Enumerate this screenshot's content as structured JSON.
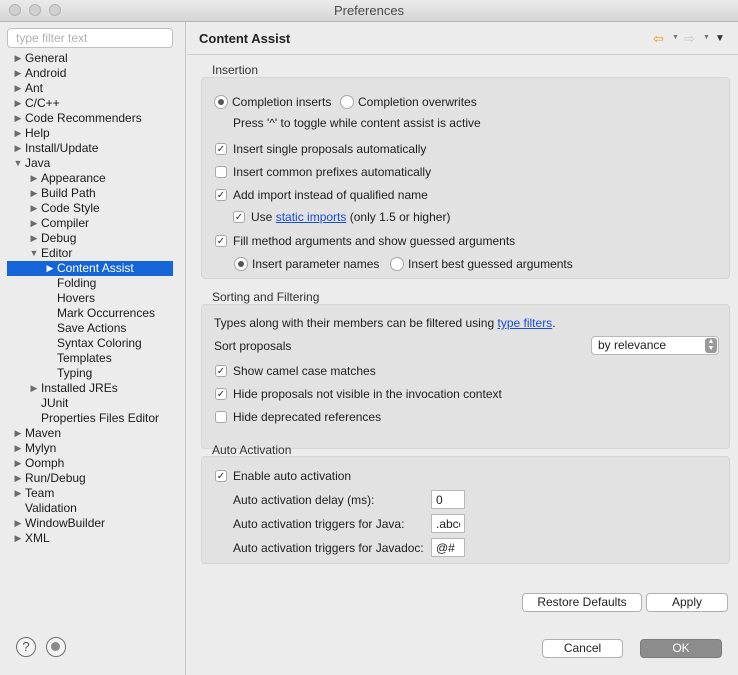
{
  "window": {
    "title": "Preferences"
  },
  "filter": {
    "placeholder": "type filter text"
  },
  "tree": [
    {
      "label": "General",
      "arrow": "▶",
      "depth": 0
    },
    {
      "label": "Android",
      "arrow": "▶",
      "depth": 0
    },
    {
      "label": "Ant",
      "arrow": "▶",
      "depth": 0
    },
    {
      "label": "C/C++",
      "arrow": "▶",
      "depth": 0
    },
    {
      "label": "Code Recommenders",
      "arrow": "▶",
      "depth": 0
    },
    {
      "label": "Help",
      "arrow": "▶",
      "depth": 0
    },
    {
      "label": "Install/Update",
      "arrow": "▶",
      "depth": 0
    },
    {
      "label": "Java",
      "arrow": "▼",
      "depth": 0
    },
    {
      "label": "Appearance",
      "arrow": "▶",
      "depth": 1
    },
    {
      "label": "Build Path",
      "arrow": "▶",
      "depth": 1
    },
    {
      "label": "Code Style",
      "arrow": "▶",
      "depth": 1
    },
    {
      "label": "Compiler",
      "arrow": "▶",
      "depth": 1
    },
    {
      "label": "Debug",
      "arrow": "▶",
      "depth": 1
    },
    {
      "label": "Editor",
      "arrow": "▼",
      "depth": 1
    },
    {
      "label": "Content Assist",
      "arrow": "▶",
      "depth": 2,
      "selected": true
    },
    {
      "label": "Folding",
      "arrow": "",
      "depth": 2
    },
    {
      "label": "Hovers",
      "arrow": "",
      "depth": 2
    },
    {
      "label": "Mark Occurrences",
      "arrow": "",
      "depth": 2
    },
    {
      "label": "Save Actions",
      "arrow": "",
      "depth": 2
    },
    {
      "label": "Syntax Coloring",
      "arrow": "",
      "depth": 2
    },
    {
      "label": "Templates",
      "arrow": "",
      "depth": 2
    },
    {
      "label": "Typing",
      "arrow": "",
      "depth": 2
    },
    {
      "label": "Installed JREs",
      "arrow": "▶",
      "depth": 1
    },
    {
      "label": "JUnit",
      "arrow": "",
      "depth": 1
    },
    {
      "label": "Properties Files Editor",
      "arrow": "",
      "depth": 1
    },
    {
      "label": "Maven",
      "arrow": "▶",
      "depth": 0
    },
    {
      "label": "Mylyn",
      "arrow": "▶",
      "depth": 0
    },
    {
      "label": "Oomph",
      "arrow": "▶",
      "depth": 0
    },
    {
      "label": "Run/Debug",
      "arrow": "▶",
      "depth": 0
    },
    {
      "label": "Team",
      "arrow": "▶",
      "depth": 0
    },
    {
      "label": "Validation",
      "arrow": "",
      "depth": 0
    },
    {
      "label": "WindowBuilder",
      "arrow": "▶",
      "depth": 0
    },
    {
      "label": "XML",
      "arrow": "▶",
      "depth": 0
    }
  ],
  "page": {
    "title": "Content Assist"
  },
  "insertion": {
    "title": "Insertion",
    "completion_inserts": "Completion inserts",
    "completion_overwrites": "Completion overwrites",
    "toggle_hint": "Press '^' to toggle while content assist is active",
    "insert_single": "Insert single proposals automatically",
    "insert_common": "Insert common prefixes automatically",
    "add_import": "Add import instead of qualified name",
    "use_prefix": "Use",
    "static_imports": "static imports",
    "use_suffix": "(only 1.5 or higher)",
    "fill_method": "Fill method arguments and show guessed arguments",
    "insert_param_names": "Insert parameter names",
    "insert_best_guessed": "Insert best guessed arguments"
  },
  "sorting": {
    "title": "Sorting and Filtering",
    "types_prefix": "Types along with their members can be filtered using",
    "type_filters": "type filters",
    "types_suffix": ".",
    "sort_label": "Sort proposals",
    "sort_value": "by relevance",
    "camel_case": "Show camel case matches",
    "hide_not_visible": "Hide proposals not visible in the invocation context",
    "hide_deprecated": "Hide deprecated references"
  },
  "auto_activation": {
    "title": "Auto Activation",
    "enable": "Enable auto activation",
    "delay_label": "Auto activation delay (ms):",
    "delay_value": "0",
    "java_label": "Auto activation triggers for Java:",
    "java_value": ".abcd",
    "javadoc_label": "Auto activation triggers for Javadoc:",
    "javadoc_value": "@#"
  },
  "buttons": {
    "restore_defaults": "Restore Defaults",
    "apply": "Apply",
    "cancel": "Cancel",
    "ok": "OK"
  },
  "icons": {
    "back": "back-arrow-icon",
    "forward": "forward-arrow-icon",
    "menu": "view-menu-icon",
    "help": "help-icon",
    "record": "record-icon"
  },
  "colors": {
    "selection": "#1665d8",
    "link": "#1a4cd6",
    "back_arrow": "#e0a020"
  }
}
